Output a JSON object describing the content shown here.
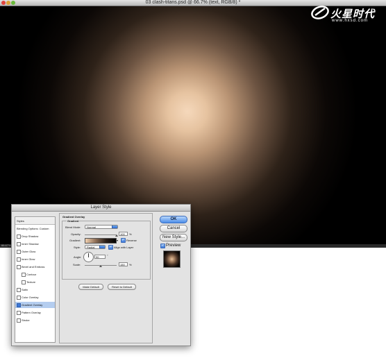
{
  "document": {
    "title": "03 clash-titans.psd @ 66.7% (text, RGB/8) *",
    "zoom": "66.67%"
  },
  "watermark": {
    "name": "火星时代",
    "url": "www.hxsd.com"
  },
  "dialog": {
    "title": "Layer Style",
    "styles_list": [
      {
        "label": "Styles",
        "checkbox": false,
        "checked": false,
        "type": "header"
      },
      {
        "label": "Blending Options: Custom",
        "checkbox": false,
        "checked": false,
        "type": "item"
      },
      {
        "label": "Drop Shadow",
        "checkbox": true,
        "checked": false,
        "type": "item"
      },
      {
        "label": "Inner Shadow",
        "checkbox": true,
        "checked": false,
        "type": "item"
      },
      {
        "label": "Outer Glow",
        "checkbox": true,
        "checked": false,
        "type": "item"
      },
      {
        "label": "Inner Glow",
        "checkbox": true,
        "checked": false,
        "type": "item"
      },
      {
        "label": "Bevel and Emboss",
        "checkbox": true,
        "checked": false,
        "type": "item"
      },
      {
        "label": "Contour",
        "checkbox": true,
        "checked": false,
        "type": "sub"
      },
      {
        "label": "Texture",
        "checkbox": true,
        "checked": false,
        "type": "sub"
      },
      {
        "label": "Satin",
        "checkbox": true,
        "checked": false,
        "type": "item"
      },
      {
        "label": "Color Overlay",
        "checkbox": true,
        "checked": false,
        "type": "item"
      },
      {
        "label": "Gradient Overlay",
        "checkbox": true,
        "checked": true,
        "type": "selected"
      },
      {
        "label": "Pattern Overlay",
        "checkbox": true,
        "checked": false,
        "type": "item"
      },
      {
        "label": "Stroke",
        "checkbox": true,
        "checked": false,
        "type": "item"
      }
    ],
    "panel": {
      "section_title": "Gradient Overlay",
      "group_title": "Gradient",
      "blend_mode_label": "Blend Mode:",
      "blend_mode_value": "Normal",
      "opacity_label": "Opacity:",
      "opacity_value": "100",
      "opacity_unit": "%",
      "opacity_level": 1.0,
      "gradient_label": "Gradient:",
      "reverse_label": "Reverse",
      "reverse_checked": true,
      "style_label": "Style:",
      "style_value": "Radial",
      "align_label": "Align with Layer",
      "align_checked": true,
      "angle_label": "Angle:",
      "angle_value": "90",
      "angle_unit": "°",
      "scale_label": "Scale:",
      "scale_value": "150",
      "scale_unit": "%",
      "scale_level": 0.5,
      "make_default_label": "Make Default",
      "reset_default_label": "Reset to Default"
    },
    "buttons": {
      "ok": "OK",
      "cancel": "Cancel",
      "new_style": "New Style...",
      "preview_label": "Preview",
      "preview_checked": true
    }
  },
  "colors": {
    "accent": "#4c8ee9",
    "canvas_bg": "#000000",
    "glow": "#f5d8bb"
  }
}
